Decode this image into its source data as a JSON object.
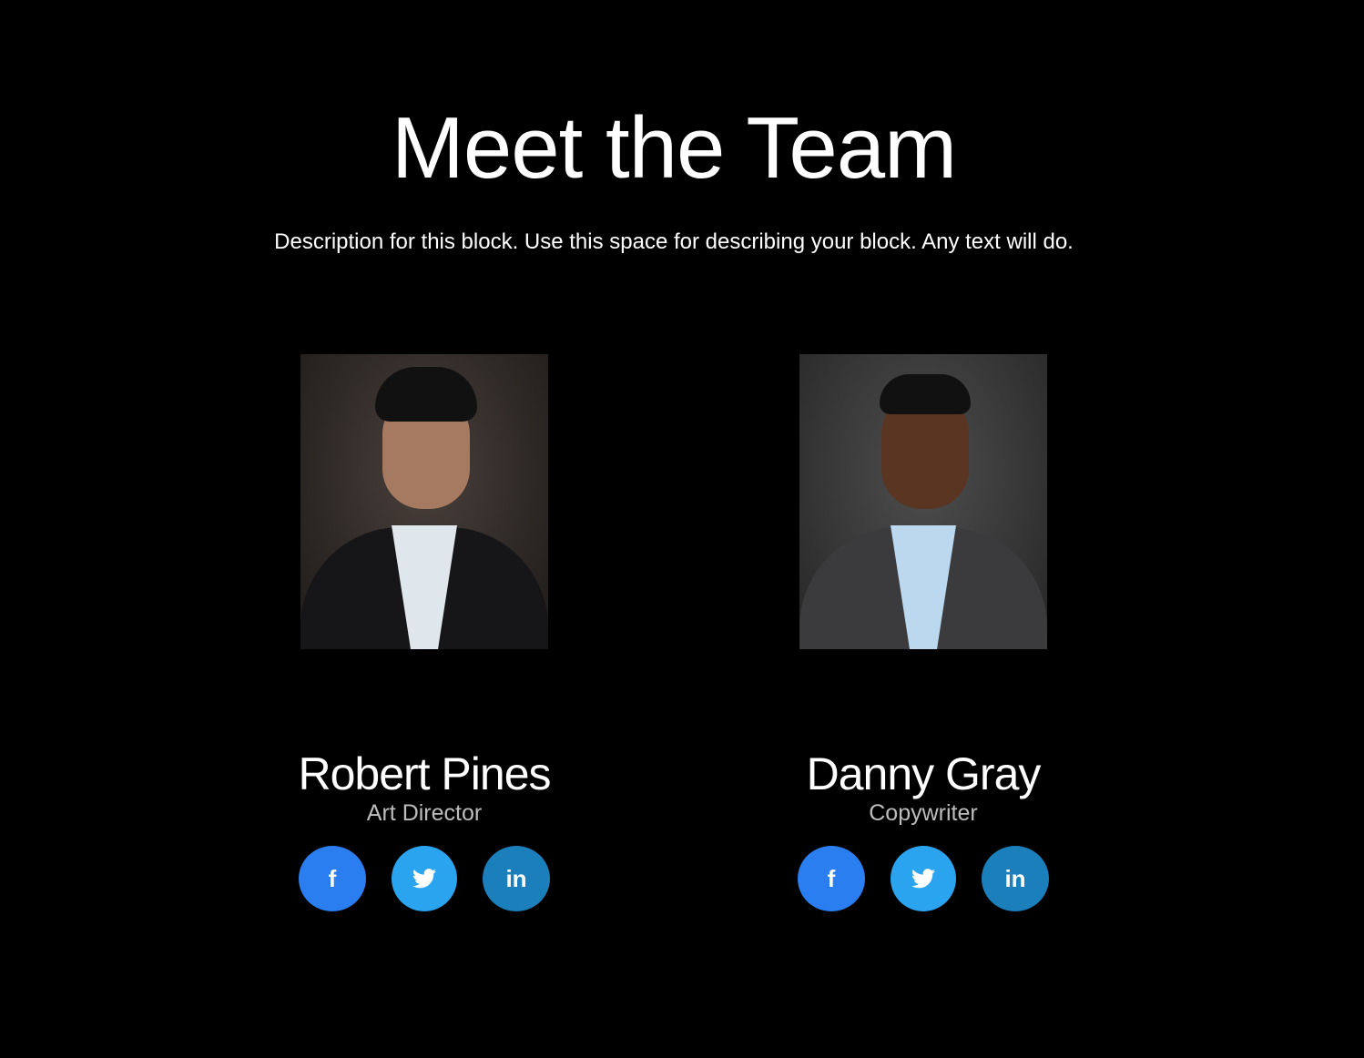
{
  "header": {
    "title": "Meet the Team",
    "description": "Description for this block. Use this space for describing your block. Any text will do."
  },
  "colors": {
    "facebook": "#2a7ef0",
    "twitter": "#2ba4ef",
    "linkedin": "#1a7fbb",
    "background": "#000000"
  },
  "members": [
    {
      "name": "Robert Pines",
      "role": "Art Director",
      "socials": [
        {
          "icon": "facebook-icon",
          "glyph": "f"
        },
        {
          "icon": "twitter-icon",
          "glyph": "🐦"
        },
        {
          "icon": "linkedin-icon",
          "glyph": "in"
        }
      ]
    },
    {
      "name": "Danny Gray",
      "role": "Copywriter",
      "socials": [
        {
          "icon": "facebook-icon",
          "glyph": "f"
        },
        {
          "icon": "twitter-icon",
          "glyph": "🐦"
        },
        {
          "icon": "linkedin-icon",
          "glyph": "in"
        }
      ]
    }
  ]
}
